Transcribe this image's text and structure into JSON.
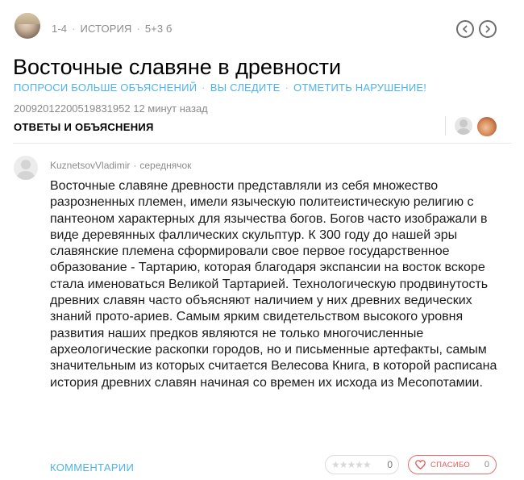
{
  "question": {
    "meta": {
      "grade": "1-4",
      "subject": "ИСТОРИЯ",
      "points": "5+3 б"
    },
    "title": "Восточные славяне в древности",
    "actions": {
      "ask_more": "ПОПРОСИ БОЛЬШЕ ОБЪЯСНЕНИЙ",
      "follow": "ВЫ СЛЕДИТЕ",
      "report": "ОТМЕТИТЬ НАРУШЕНИЕ!"
    },
    "asked": "20092012200519831952 12 минут назад"
  },
  "answers_section": {
    "heading": "ОТВЕТЫ И ОБЪЯСНЕНИЯ"
  },
  "answer": {
    "author": "KuznetsovVladimir",
    "rank": "середнячок",
    "text": "Восточные славяне древности представляли из себя множество разрозненных племен, имели языческую политеистическую религию с пантеоном характерных для язычества богов. Богов часто изображали в виде деревянных фаллических скульптур. К 300 году до нашей эры славянские племена сформировали свое первое государственное образование - Тартарию, которая благодаря экспансии на восток вскоре стала именоваться Великой Тартарией. Технологическую продвинутость древних славян часто объясняют наличием у них древних ведических знаний прото-ариев. Самым ярким свидетельством высокого уровня развития наших предков являются не только многочисленные археологические раскопки городов, но и письменные артефакты, самым значительным из которых считается Велесова Книга, в которой расписана история древних славян начиная со времен их исхода из Месопотамии.",
    "comments_label": "КОММЕНТАРИИ",
    "rating": {
      "stars": 0,
      "count": "0"
    },
    "thanks": {
      "label": "СПАСИБО",
      "count": "0"
    }
  },
  "colors": {
    "accent_blue": "#4fb3e6",
    "thanks_red": "#e35858",
    "muted_gray": "#8c8c8c"
  },
  "icons": [
    "asker-avatar",
    "prev-arrow-icon",
    "next-arrow-icon",
    "follower-avatar",
    "author-avatar",
    "star-icon",
    "heart-icon"
  ]
}
